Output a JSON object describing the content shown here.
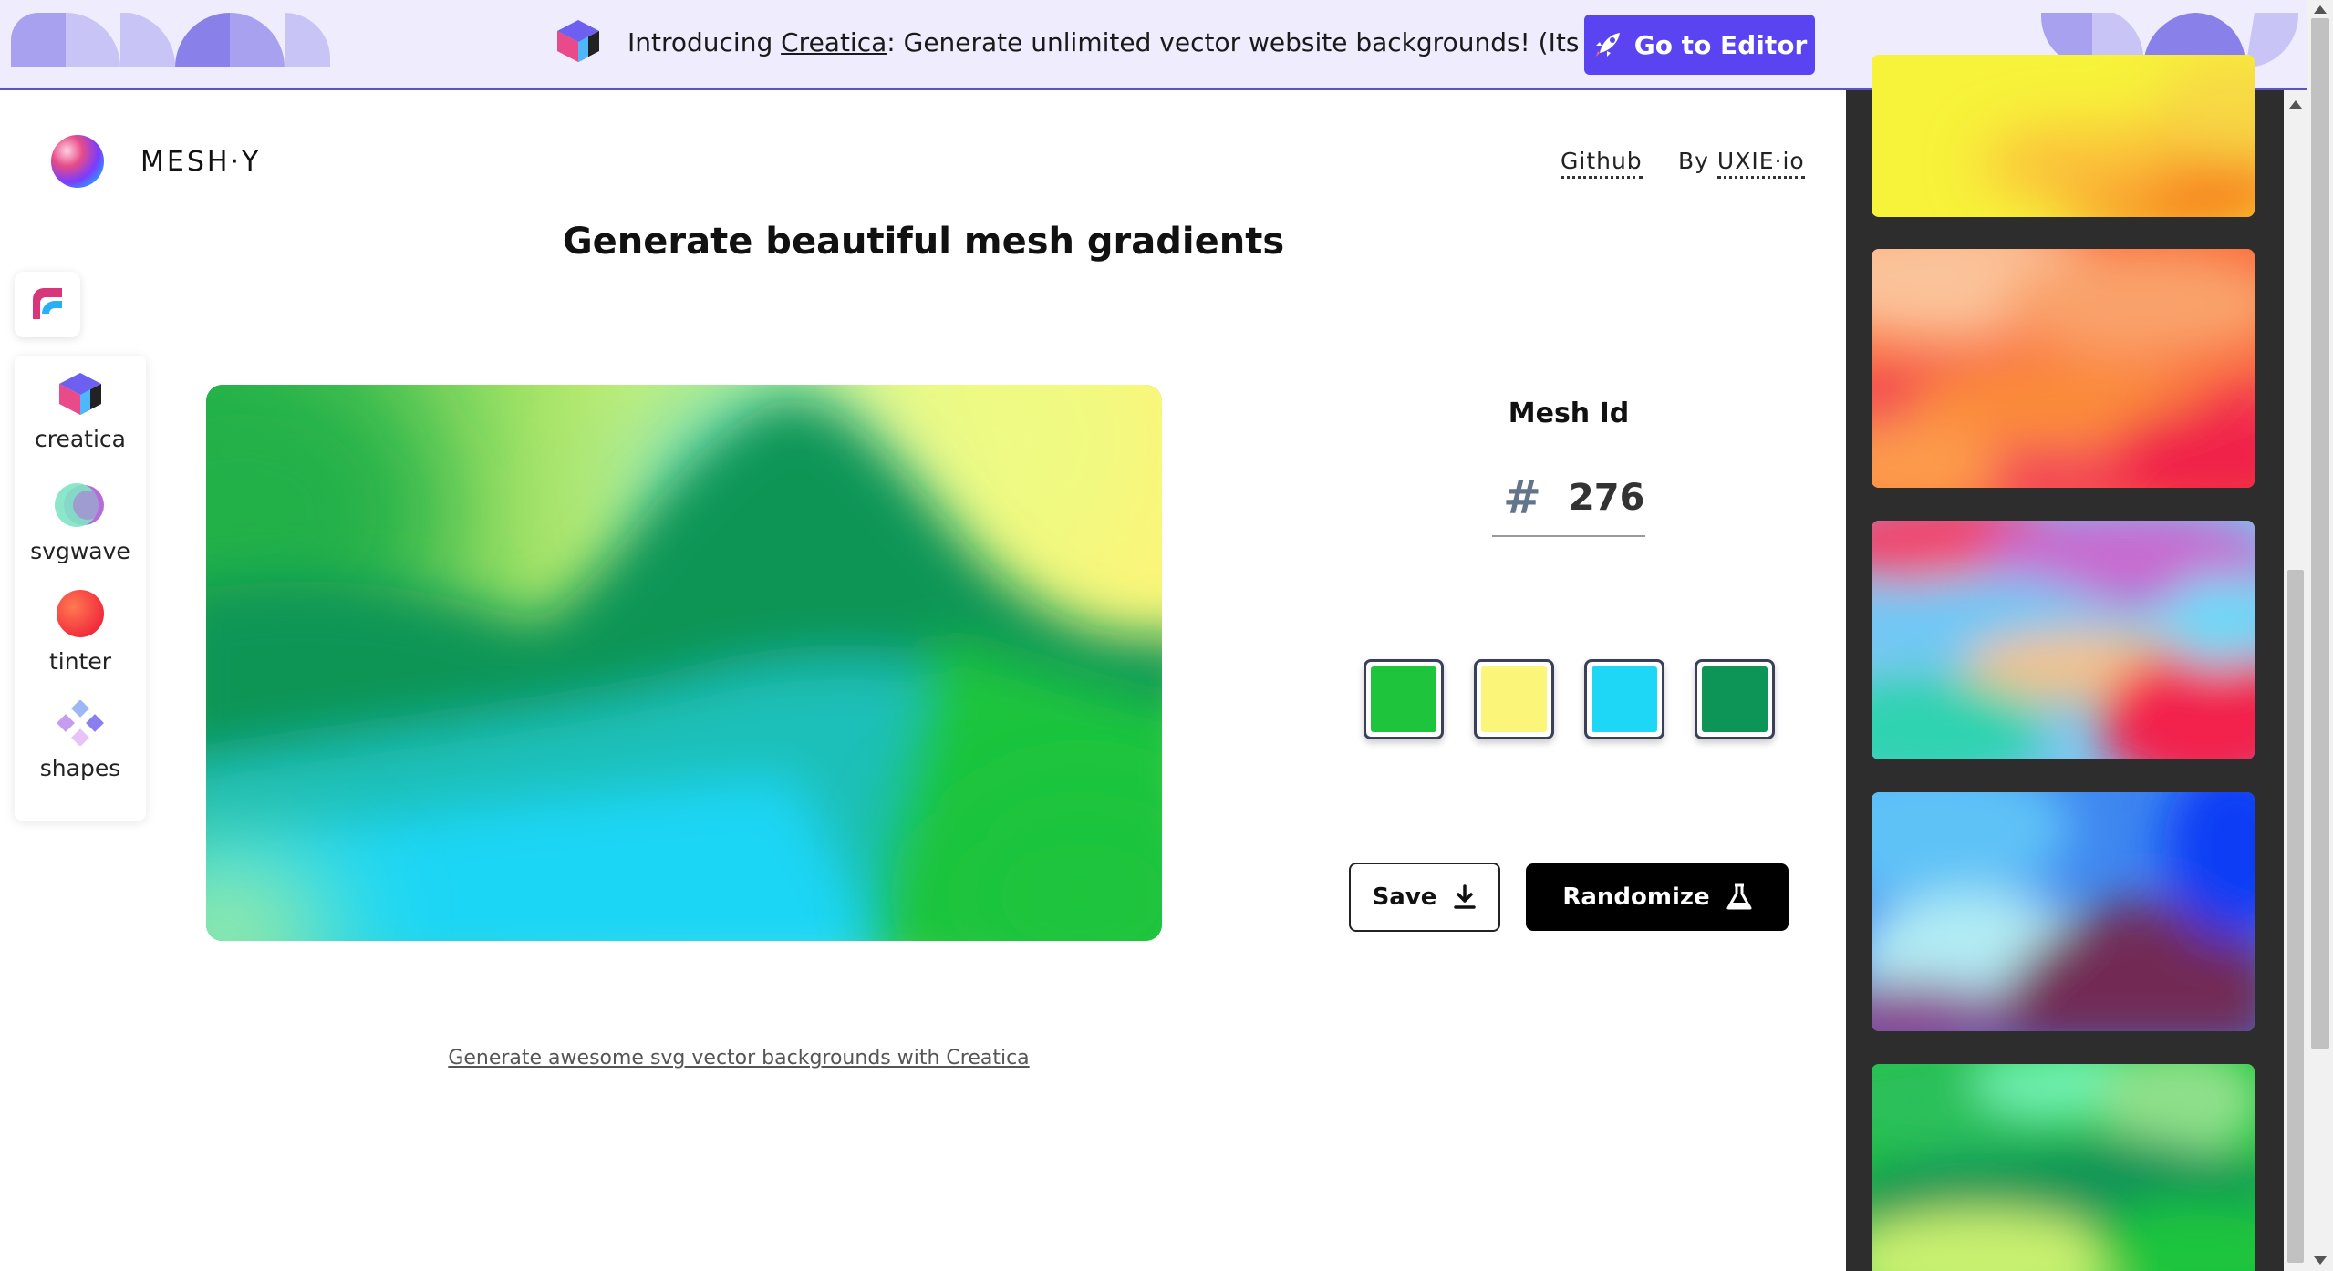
{
  "banner": {
    "intro": "Introducing ",
    "brand_link": "Creatica",
    "rest": ": Generate unlimited vector website backgrounds! (Its free)",
    "editor_button": "Go to Editor",
    "icons": [
      "cube-logo-icon",
      "rocket-icon"
    ]
  },
  "header": {
    "brand": "MESH·Y",
    "github": "Github",
    "by_prefix": "By ",
    "by_link": "UXIE·io"
  },
  "headline": "Generate beautiful mesh gradients",
  "sidebar": {
    "items": [
      {
        "label": "creatica",
        "icon": "creatica-cube-icon"
      },
      {
        "label": "svgwave",
        "icon": "svgwave-orbs-icon"
      },
      {
        "label": "tinter",
        "icon": "tinter-circle-icon"
      },
      {
        "label": "shapes",
        "icon": "shapes-diamonds-icon"
      }
    ]
  },
  "mesh": {
    "label": "Mesh Id",
    "hash": "#",
    "id": "276",
    "colors": [
      "#1ec43c",
      "#fbf67a",
      "#1ed6f5",
      "#0d9557"
    ]
  },
  "actions": {
    "save": "Save",
    "randomize": "Randomize"
  },
  "footer_link": "Generate awesome svg vector backgrounds with Creatica",
  "accent": "#5a43f0"
}
